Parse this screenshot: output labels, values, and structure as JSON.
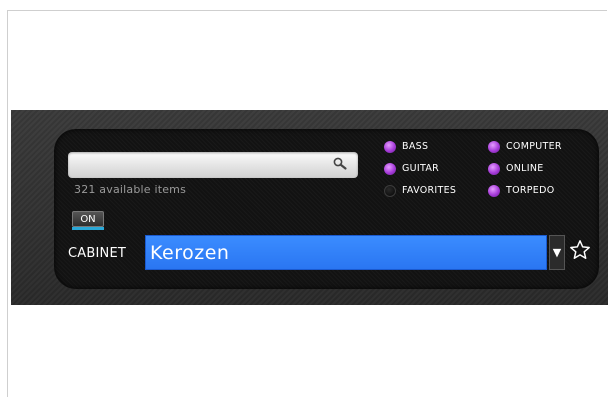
{
  "search": {
    "value": "",
    "placeholder": "",
    "available_text": "321 available items"
  },
  "filters": [
    {
      "label": "BASS",
      "active": true
    },
    {
      "label": "COMPUTER",
      "active": true
    },
    {
      "label": "GUITAR",
      "active": true
    },
    {
      "label": "ONLINE",
      "active": true
    },
    {
      "label": "FAVORITES",
      "active": false
    },
    {
      "label": "TORPEDO",
      "active": true
    }
  ],
  "on_button": {
    "label": "ON"
  },
  "cabinet": {
    "label": "CABINET",
    "value": "Kerozen"
  },
  "colors": {
    "accent_blue": "#2f7ff7",
    "filter_active": "#a53ad8",
    "on_indicator": "#2aa8d8",
    "panel": "#141414"
  },
  "icons": [
    "search-icon",
    "dropdown-arrow-icon",
    "star-icon"
  ]
}
